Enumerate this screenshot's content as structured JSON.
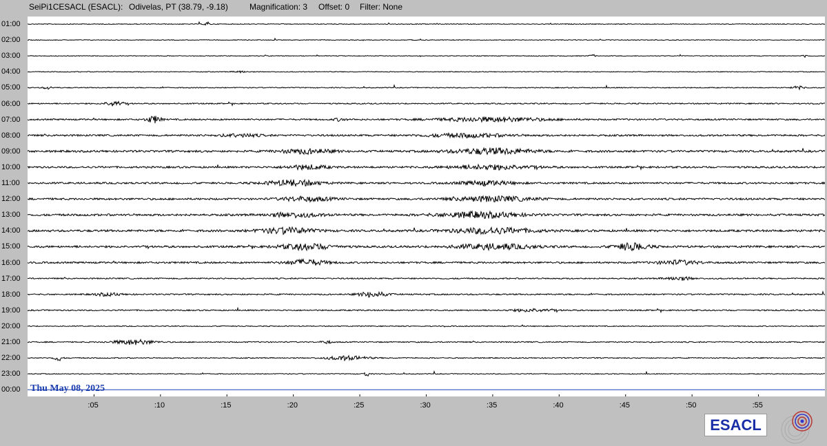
{
  "header": {
    "station": "SeiPi1CESACL (ESACL):",
    "location": "Odivelas, PT (38.79, -9.18)",
    "magnification": "Magnification: 3",
    "offset": "Offset: 0",
    "filter": "Filter: None"
  },
  "date_label": "Thu May 08, 2025",
  "logo_text": "ESACL",
  "colors": {
    "background": "#c0c0c0",
    "plot": "#ffffff",
    "trace": "#000000",
    "current_line": "#1c3fb0",
    "logo": "#1a2ea8"
  },
  "chart_data": {
    "type": "line",
    "title": "",
    "xlabel": "",
    "ylabel": "",
    "x_range_minutes": [
      0,
      60
    ],
    "x_tick_labels": [
      ":05",
      ":10",
      ":15",
      ":20",
      ":25",
      ":30",
      ":35",
      ":40",
      ":45",
      ":50",
      ":55"
    ],
    "x_tick_values": [
      5,
      10,
      15,
      20,
      25,
      30,
      35,
      40,
      45,
      50,
      55
    ],
    "rows": [
      {
        "label": "01:00",
        "noise": 0.4,
        "bursts": [
          [
            13.5,
            0.2,
            3
          ]
        ]
      },
      {
        "label": "02:00",
        "noise": 0.3,
        "bursts": []
      },
      {
        "label": "03:00",
        "noise": 0.35,
        "bursts": [
          [
            42.5,
            0.2,
            2
          ],
          [
            58.5,
            0.2,
            2
          ]
        ]
      },
      {
        "label": "04:00",
        "noise": 0.4,
        "bursts": [
          [
            16,
            0.5,
            1.5
          ]
        ]
      },
      {
        "label": "05:00",
        "noise": 0.6,
        "bursts": [
          [
            1.5,
            0.3,
            2
          ],
          [
            58,
            0.5,
            2
          ]
        ]
      },
      {
        "label": "06:00",
        "noise": 0.9,
        "bursts": [
          [
            6.5,
            0.6,
            4
          ]
        ]
      },
      {
        "label": "07:00",
        "noise": 1.3,
        "bursts": [
          [
            9.5,
            0.5,
            5
          ],
          [
            23.5,
            0.4,
            2
          ],
          [
            35,
            4,
            3
          ]
        ]
      },
      {
        "label": "08:00",
        "noise": 1.6,
        "bursts": [
          [
            16,
            1.5,
            2
          ],
          [
            33,
            3,
            2.5
          ]
        ]
      },
      {
        "label": "09:00",
        "noise": 1.9,
        "bursts": [
          [
            21,
            2,
            3
          ],
          [
            35,
            3,
            4
          ]
        ]
      },
      {
        "label": "10:00",
        "noise": 1.7,
        "bursts": [
          [
            21,
            1.5,
            3
          ],
          [
            35,
            3,
            3
          ]
        ]
      },
      {
        "label": "11:00",
        "noise": 1.6,
        "bursts": [
          [
            20,
            2,
            4
          ],
          [
            34.5,
            2,
            3
          ]
        ]
      },
      {
        "label": "12:00",
        "noise": 1.7,
        "bursts": [
          [
            21,
            2,
            3
          ],
          [
            35,
            3,
            3.5
          ]
        ]
      },
      {
        "label": "13:00",
        "noise": 1.9,
        "bursts": [
          [
            20,
            2,
            3
          ],
          [
            34,
            3,
            4
          ]
        ]
      },
      {
        "label": "14:00",
        "noise": 2.0,
        "bursts": [
          [
            19.5,
            2,
            4
          ],
          [
            35,
            3,
            4
          ]
        ]
      },
      {
        "label": "15:00",
        "noise": 1.9,
        "bursts": [
          [
            21,
            2,
            4
          ],
          [
            35,
            3,
            3.5
          ],
          [
            45.5,
            1.2,
            5
          ]
        ]
      },
      {
        "label": "16:00",
        "noise": 1.6,
        "bursts": [
          [
            21,
            1.5,
            4
          ],
          [
            49,
            1.5,
            3
          ]
        ]
      },
      {
        "label": "17:00",
        "noise": 1.0,
        "bursts": [
          [
            49,
            1,
            2.5
          ]
        ]
      },
      {
        "label": "18:00",
        "noise": 1.1,
        "bursts": [
          [
            26,
            1,
            4
          ],
          [
            6,
            1,
            2
          ]
        ]
      },
      {
        "label": "19:00",
        "noise": 1.0,
        "bursts": [
          [
            38,
            1.5,
            2
          ]
        ]
      },
      {
        "label": "20:00",
        "noise": 0.6,
        "bursts": []
      },
      {
        "label": "21:00",
        "noise": 0.8,
        "bursts": [
          [
            8,
            1.5,
            3.5
          ],
          [
            22.5,
            0.4,
            2
          ]
        ]
      },
      {
        "label": "22:00",
        "noise": 0.7,
        "bursts": [
          [
            2.3,
            0.3,
            4
          ],
          [
            24,
            1.5,
            3
          ]
        ]
      },
      {
        "label": "23:00",
        "noise": 0.5,
        "bursts": [
          [
            25.5,
            0.2,
            4
          ]
        ]
      },
      {
        "label": "00:00",
        "noise": 0,
        "bursts": [],
        "current": true
      }
    ]
  }
}
